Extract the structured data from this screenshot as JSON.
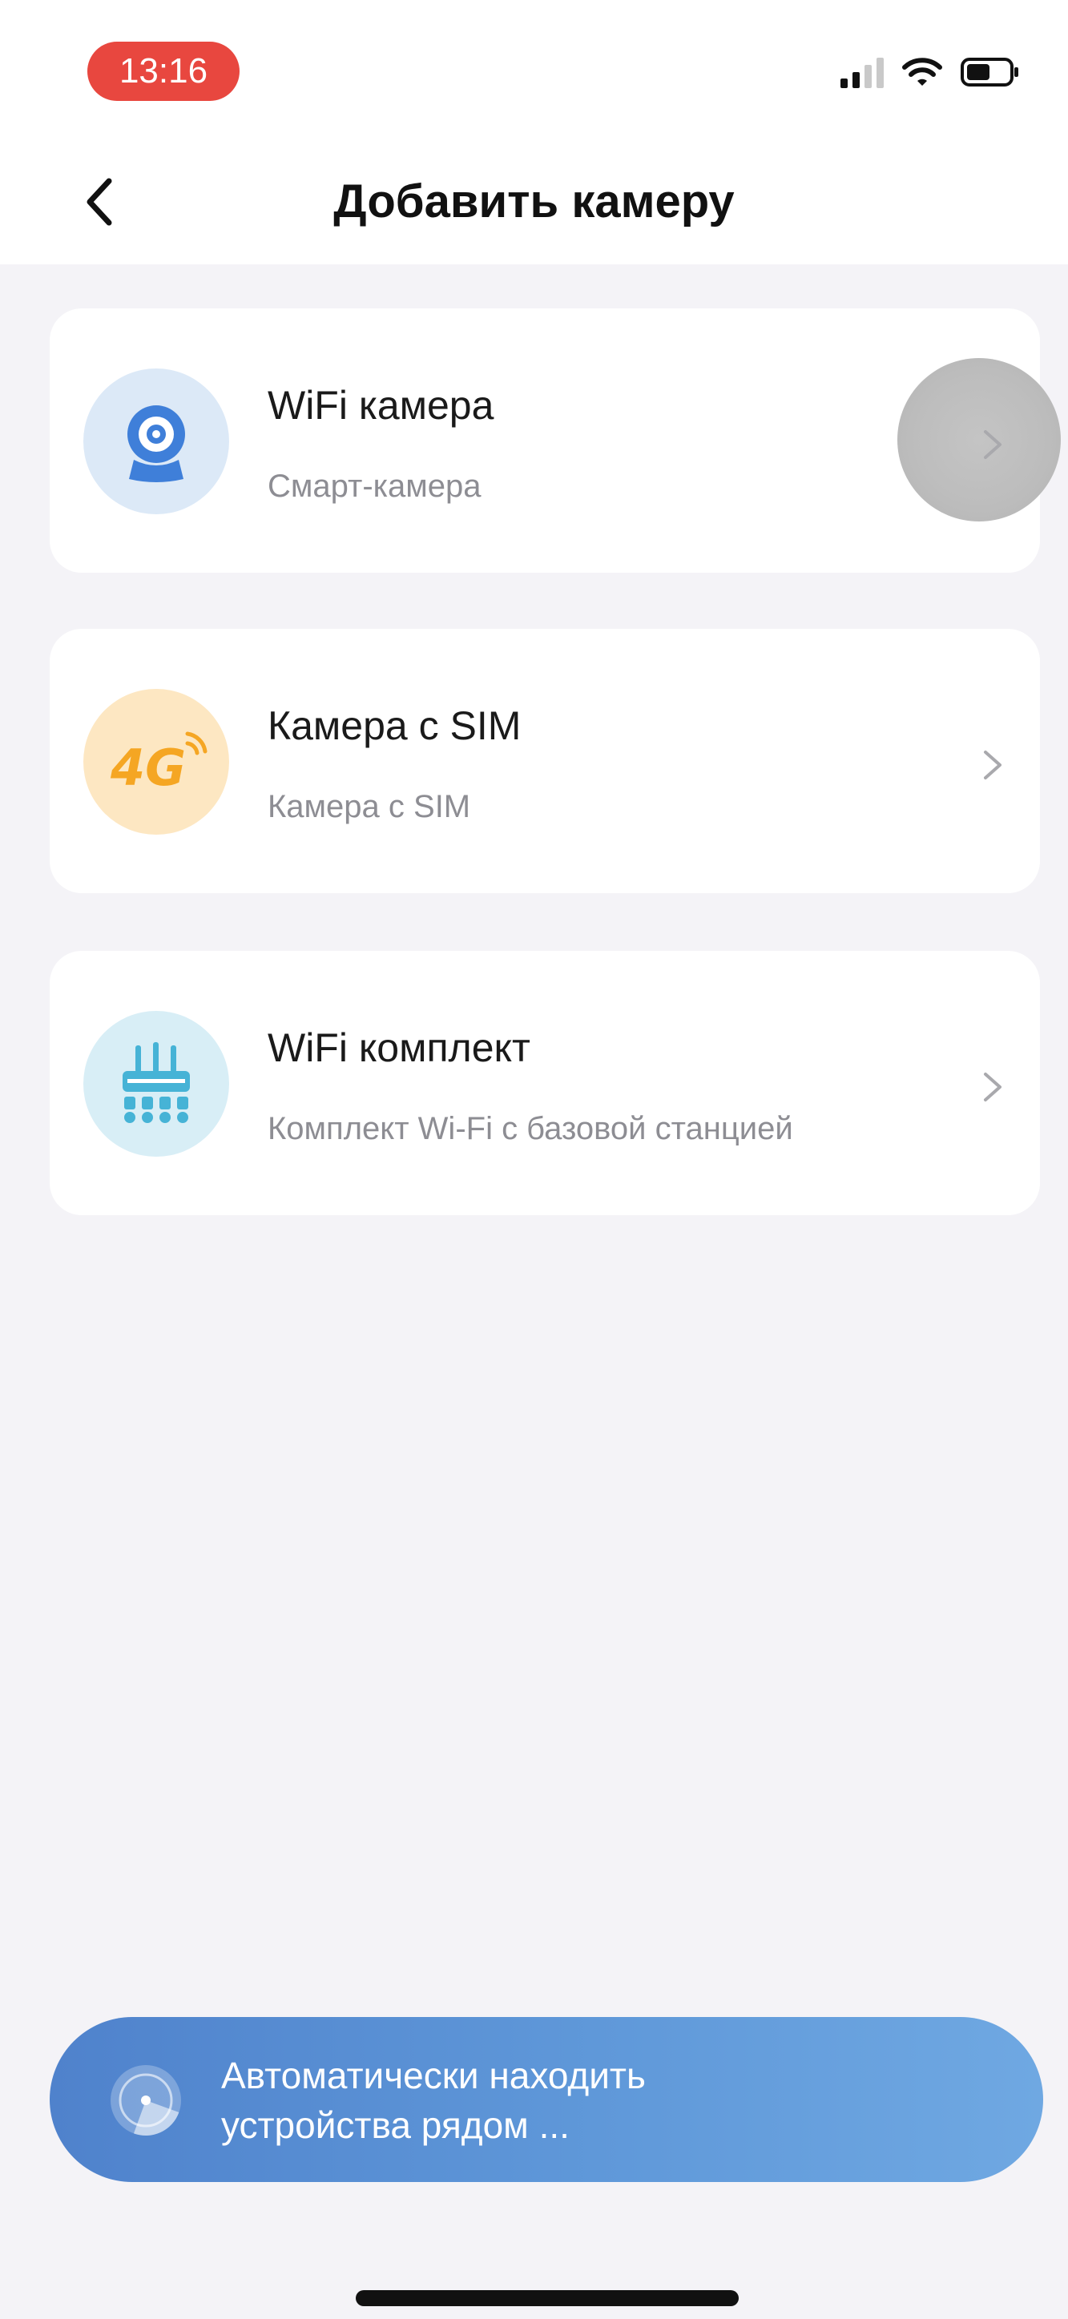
{
  "status_bar": {
    "time": "13:16",
    "icons": [
      "cellular-signal-icon",
      "wifi-icon",
      "battery-icon"
    ]
  },
  "header": {
    "title": "Добавить камеру",
    "back_icon": "chevron-left-icon"
  },
  "options": [
    {
      "title": "WiFi камера",
      "subtitle": "Смарт-камера",
      "icon": "camera-icon",
      "icon_bg": "#dce9f7"
    },
    {
      "title": "Камера с SIM",
      "subtitle": "Камера с SIM",
      "icon": "4g-icon",
      "icon_bg": "#fde7c2"
    },
    {
      "title": "WiFi комплект",
      "subtitle": "Комплект Wi-Fi с базовой станцией",
      "icon": "nvr-kit-icon",
      "icon_bg": "#d8eef6"
    }
  ],
  "scan_banner": {
    "line1": "Автоматически находить",
    "line2": "устройства рядом ...",
    "icon": "radar-scan-icon"
  },
  "colors": {
    "time_pill": "#e8473f",
    "background": "#f4f3f7",
    "banner_start": "#4f82cc",
    "banner_end": "#6fa8e2",
    "camera_accent": "#3f7fd9",
    "fourg_accent": "#f5a623"
  }
}
